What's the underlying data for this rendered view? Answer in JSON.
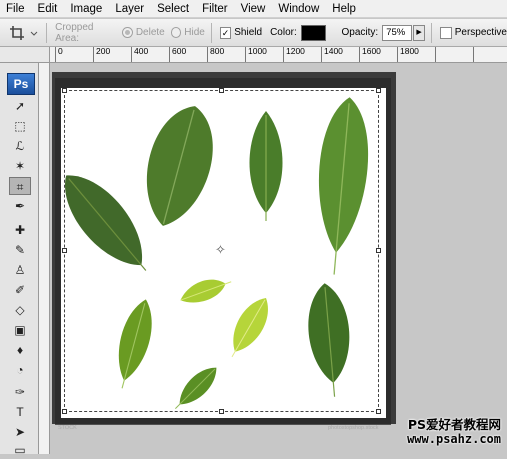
{
  "menu": [
    "File",
    "Edit",
    "Image",
    "Layer",
    "Select",
    "Filter",
    "View",
    "Window",
    "Help"
  ],
  "options": {
    "cropped_area_label": "Cropped Area:",
    "delete_label": "Delete",
    "hide_label": "Hide",
    "shield_label": "Shield",
    "shield_checked": true,
    "color_label": "Color:",
    "shield_color": "#000000",
    "opacity_label": "Opacity:",
    "opacity_value": "75%",
    "perspective_label": "Perspective",
    "perspective_checked": false
  },
  "ruler": {
    "labels": [
      "0",
      "200",
      "400",
      "600",
      "800",
      "1000",
      "1200",
      "1400",
      "1600",
      "1800"
    ]
  },
  "toolbox": {
    "logo": "Ps"
  },
  "document": {
    "corner_left_text": "STOCK",
    "corner_right_text": "photostopshop.stock"
  },
  "watermark": {
    "line1": "PS爱好者教程网",
    "line2": "www.psahz.com"
  },
  "colors": {
    "leaf_dark": "#3f6a22",
    "leaf_mid": "#5c8f2c",
    "leaf_light": "#b6d53a",
    "shield": "#282828"
  }
}
